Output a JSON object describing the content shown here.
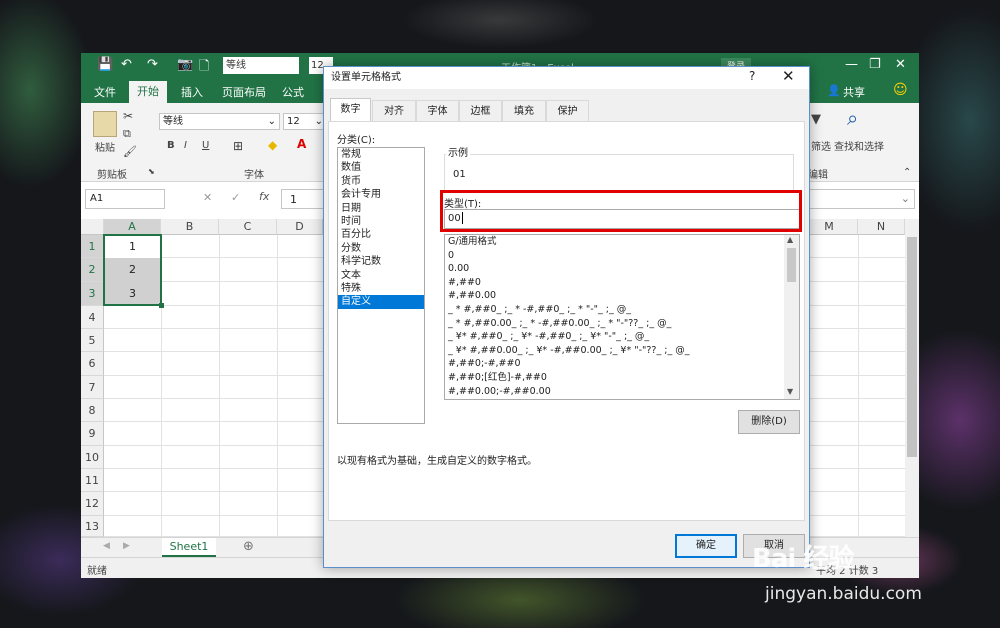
{
  "excel": {
    "quick_access": [
      "💾",
      "↶",
      "↷",
      "📷",
      "🗋"
    ],
    "font_name_box": "等线",
    "font_size_box": "12",
    "title_text": "工作簿1 - Excel",
    "sign_in": "登录",
    "window_controls": {
      "minimize": "—",
      "restore": "❐",
      "close": "✕"
    },
    "ribbon_tabs": [
      "文件",
      "开始",
      "插入",
      "页面布局",
      "公式"
    ],
    "share": "共享",
    "ribbon": {
      "paste": "粘贴",
      "clipboard": "剪贴板",
      "font_name": "等线",
      "font_size": "12",
      "font_group": "字体",
      "bold": "B",
      "italic": "I",
      "underline": "U",
      "filter": "筛选",
      "find_select": "查找和选择",
      "editing": "编辑"
    },
    "name_box": "A1",
    "formula_value": "1",
    "columns_left": [
      "A",
      "B",
      "C",
      "D"
    ],
    "columns_right": [
      "M",
      "N"
    ],
    "rows": [
      "1",
      "2",
      "3",
      "4",
      "5",
      "6",
      "7",
      "8",
      "9",
      "10",
      "11",
      "12",
      "13"
    ],
    "cells": {
      "A1": "1",
      "A2": "2",
      "A3": "3"
    },
    "sheet_tab": "Sheet1",
    "status_ready": "就绪",
    "status_right": "平均 2   计数 3"
  },
  "dialog": {
    "title": "设置单元格格式",
    "help": "?",
    "close": "✕",
    "tabs": [
      "数字",
      "对齐",
      "字体",
      "边框",
      "填充",
      "保护"
    ],
    "category_label": "分类(C):",
    "categories": [
      "常规",
      "数值",
      "货币",
      "会计专用",
      "日期",
      "时间",
      "百分比",
      "分数",
      "科学记数",
      "文本",
      "特殊",
      "自定义"
    ],
    "selected_category": "自定义",
    "sample_label": "示例",
    "sample_value": "01",
    "type_label": "类型(T):",
    "type_value": "00",
    "formats": [
      "G/通用格式",
      "0",
      "0.00",
      "#,##0",
      "#,##0.00",
      "_ * #,##0_ ;_ * -#,##0_ ;_ * \"-\"_ ;_ @_ ",
      "_ * #,##0.00_ ;_ * -#,##0.00_ ;_ * \"-\"??_ ;_ @_ ",
      "_ ¥* #,##0_ ;_ ¥* -#,##0_ ;_ ¥* \"-\"_ ;_ @_ ",
      "_ ¥* #,##0.00_ ;_ ¥* -#,##0.00_ ;_ ¥* \"-\"??_ ;_ @_ ",
      "#,##0;-#,##0",
      "#,##0;[红色]-#,##0",
      "#,##0.00;-#,##0.00"
    ],
    "delete_button": "删除(D)",
    "description": "以现有格式为基础，生成自定义的数字格式。",
    "ok_button": "确定",
    "cancel_button": "取消"
  },
  "watermark": {
    "logo": "Bai 经验",
    "url": "jingyan.baidu.com"
  },
  "colors": {
    "excel_green": "#217346",
    "highlight_red": "#e00000",
    "selection_blue": "#0078d7"
  }
}
